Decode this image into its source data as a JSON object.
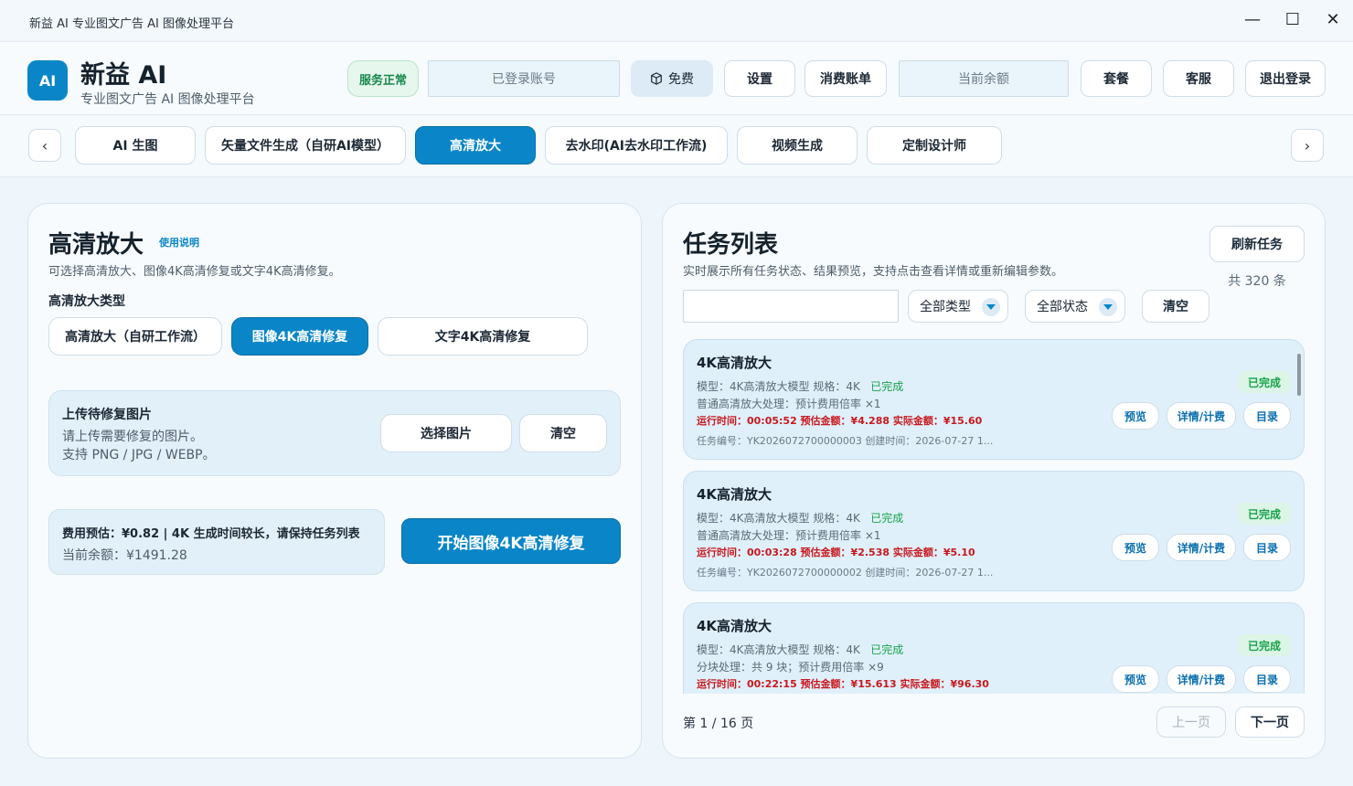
{
  "window": {
    "title": "新益 AI  专业图文广告 AI 图像处理平台",
    "controls": [
      "—",
      "☐",
      "✕"
    ]
  },
  "header": {
    "logo_text": "AI",
    "brand": "新益 AI",
    "subtitle": "专业图文广告 AI 图像处理平台",
    "status": "服务正常",
    "account_placeholder": "已登录账号",
    "free_label": "免费",
    "settings": "设置",
    "bills": "消费账单",
    "balance_placeholder": "当前余额",
    "plans": "套餐",
    "support": "客服",
    "logout": "退出登录"
  },
  "nav": {
    "prev": "‹",
    "next": "›",
    "tabs": [
      "AI 生图",
      "矢量文件生成（自研AI模型）",
      "高清放大",
      "去水印(AI去水印工作流)",
      "视频生成",
      "定制设计师"
    ],
    "active_index": 2
  },
  "left": {
    "title": "高清放大",
    "help": "使用说明",
    "desc": "可选择高清放大、图像4K高清修复或文字4K高清修复。",
    "type_label": "高清放大类型",
    "types": [
      "高清放大（自研工作流）",
      "图像4K高清修复",
      "文字4K高清修复"
    ],
    "active_type": 1,
    "upload": {
      "title": "上传待修复图片",
      "line1": "请上传需要修复的图片。",
      "line2": "支持 PNG / JPG / WEBP。",
      "select": "选择图片",
      "clear": "清空"
    },
    "cost": {
      "line1": "费用预估：¥0.82  |  4K 生成时间较长，请保持任务列表",
      "line2": "当前余额：¥1491.28"
    },
    "start": "开始图像4K高清修复"
  },
  "right": {
    "title": "任务列表",
    "desc": "实时展示所有任务状态、结果预览，支持点击查看详情或重新编辑参数。",
    "refresh": "刷新任务",
    "total": "共 320 条",
    "search_value": "",
    "filter_type": "全部类型",
    "filter_status": "全部状态",
    "clear": "清空",
    "tasks": [
      {
        "title": "4K高清放大",
        "model": "模型：4K高清放大模型    规格：4K",
        "state": "已完成",
        "mode": "普通高清放大处理：预计费用倍率 ×1",
        "runtime": "运行时间：00:05:52    预估金额：¥4.288    实际金额：¥15.60",
        "meta": "任务编号：YK2026072700000003     创建时间：2026-07-27 1...",
        "badge": "已完成",
        "preview": "预览",
        "detail": "详情/计费",
        "folder": "目录"
      },
      {
        "title": "4K高清放大",
        "model": "模型：4K高清放大模型    规格：4K",
        "state": "已完成",
        "mode": "普通高清放大处理：预计费用倍率 ×1",
        "runtime": "运行时间：00:03:28    预估金额：¥2.538    实际金额：¥5.10",
        "meta": "任务编号：YK2026072700000002     创建时间：2026-07-27 1...",
        "badge": "已完成",
        "preview": "预览",
        "detail": "详情/计费",
        "folder": "目录"
      },
      {
        "title": "4K高清放大",
        "model": "模型：4K高清放大模型    规格：4K",
        "state": "已完成",
        "mode": "分块处理：共 9 块；预计费用倍率 ×9",
        "runtime": "运行时间：00:22:15    预估金额：¥15.613    实际金额：¥96.30",
        "meta": "",
        "badge": "已完成",
        "preview": "预览",
        "detail": "详情/计费",
        "folder": "目录"
      }
    ],
    "page_info": "第 1 / 16 页",
    "prev_page": "上一页",
    "next_page": "下一页"
  }
}
